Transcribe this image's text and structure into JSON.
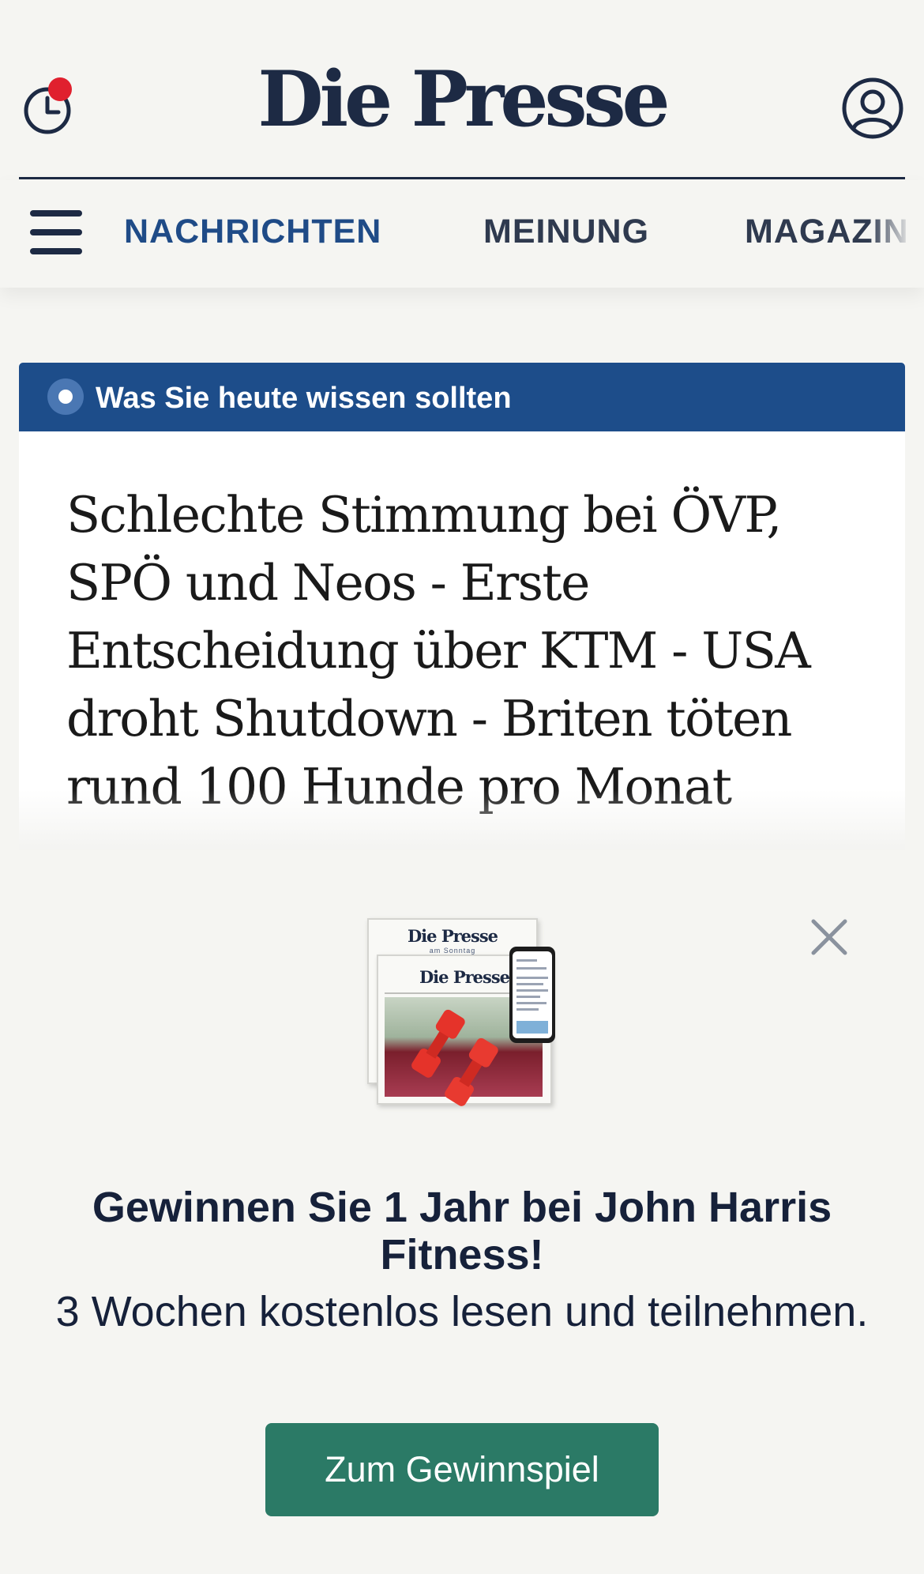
{
  "header": {
    "logo": "Die Presse",
    "history_icon": "history-clock-icon",
    "account_icon": "user-account-icon",
    "notification_color": "#e0202e"
  },
  "nav": {
    "items": [
      {
        "label": "NACHRICHTEN",
        "active": true
      },
      {
        "label": "MEINUNG",
        "active": false
      },
      {
        "label": "MAGAZIN",
        "active": false
      }
    ]
  },
  "card": {
    "banner": "Was Sie heute wissen sollten",
    "headline": "Schlechte Stimmung bei ÖVP, SPÖ und Neos - Erste Entscheidung über KTM - USA droht Shutdown - Briten töten rund 100 Hunde pro Monat"
  },
  "promo": {
    "paper_masthead_1": "Die Presse",
    "paper_sub_1": "am Sonntag",
    "paper_masthead_2": "Die Presse",
    "title": "Gewinnen Sie 1 Jahr bei John Harris Fitness!",
    "subtitle": "3 Wochen kostenlos lesen und teilnehmen.",
    "cta_label": "Zum Gewinnspiel"
  },
  "colors": {
    "brand_navy": "#1d2a44",
    "banner_blue": "#1d4d8a",
    "nav_active": "#1f4b87",
    "cta_green": "#2b7a66"
  }
}
